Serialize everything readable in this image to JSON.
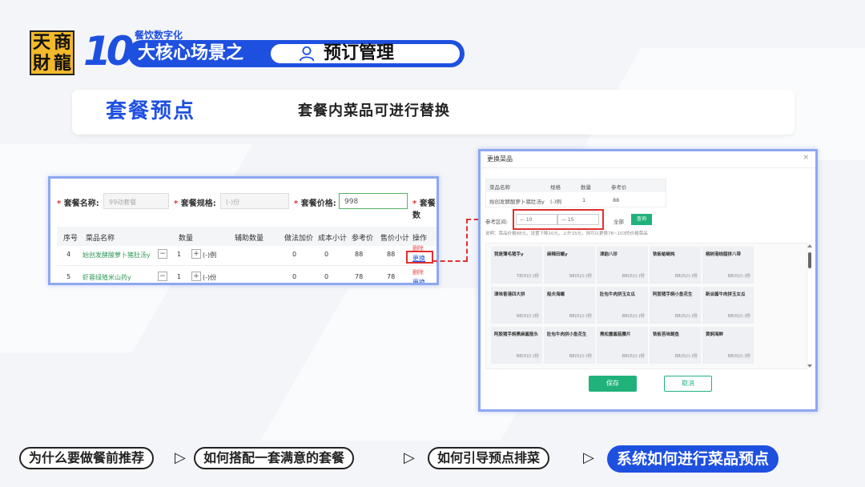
{
  "logo": {
    "chars": [
      "天",
      "商",
      "財",
      "龍"
    ]
  },
  "header": {
    "number": "10",
    "tag": "餐饮数字化",
    "banner_text": "大核心场景之",
    "pill_text": "预订管理",
    "pill_icon": "user-icon"
  },
  "section": {
    "title": "套餐预点",
    "description": "套餐内菜品可进行替换"
  },
  "left_panel": {
    "fields": [
      {
        "label": "套餐名称:",
        "placeholder": "99动套餐"
      },
      {
        "label": "套餐规格:",
        "placeholder": "(-)份"
      },
      {
        "label": "套餐价格:",
        "value": "998"
      },
      {
        "label": "套餐数"
      }
    ],
    "headers": [
      "序号",
      "菜品名称",
      "数量",
      "辅助数量",
      "做法加价",
      "成本小计",
      "参考价",
      "售价小计",
      "操作"
    ],
    "rows": [
      {
        "no": "4",
        "name": "始创发酵酸萝卜猪肚汤y",
        "qty": "1",
        "unit": "(-)例",
        "extra": "0",
        "cost": "0",
        "ref": "88",
        "sale": "88",
        "del": "删除",
        "replace": "更换"
      },
      {
        "no": "5",
        "name": "虾蓉绿殖米山药y",
        "qty": "1",
        "unit": "(-)份",
        "extra": "0",
        "cost": "0",
        "ref": "78",
        "sale": "78",
        "del": "删除",
        "replace": "更换"
      }
    ]
  },
  "right_panel": {
    "title": "更换菜品",
    "close": "×",
    "mini_headers": [
      "菜品名称",
      "规格",
      "数量",
      "参考价"
    ],
    "mini_row": [
      "始创发酵酸萝卜猪肚汤y",
      "(-)例",
      "1",
      "88"
    ],
    "range_label": "参考区间:",
    "range_min": "10",
    "range_max": "15",
    "range_dash": "—",
    "all_label": "全部",
    "query_btn": "查询",
    "hint": "说明：菜品价格88元，设置下降10元，上升15元，则可以更换78~103的价格菜品",
    "dishes": [
      {
        "name": "我是薄毛猪手y",
        "price": "78(0)/(-)份"
      },
      {
        "name": "麻辣田螺y",
        "price": "98(0)/(-)份"
      },
      {
        "name": "津韵八珍",
        "price": "88(0)/(-)份"
      },
      {
        "name": "铁板蛤蜊炖",
        "price": "88(0)/(-)份"
      },
      {
        "name": "榕树港烧腊拼八带",
        "price": "88(0)/(-)份"
      },
      {
        "name": "津味香港四大拼",
        "price": "98(0)/(-)份"
      },
      {
        "name": "船夫海螺",
        "price": "88(0)/(-)份"
      },
      {
        "name": "肚包牛肉拼玉女瓜",
        "price": "88(0)/(-)份"
      },
      {
        "name": "阿胶猪手焖小鱼花生",
        "price": "88(0)/(-)份"
      },
      {
        "name": "新派酱牛肉拼玉女瓜",
        "price": "88(0)/(-)份"
      },
      {
        "name": "阿胶猪手焖黑麻酱筋头",
        "price": "88(0)/(-)份"
      },
      {
        "name": "肚包牛肉拼小鱼花生",
        "price": "88(0)/(-)份"
      },
      {
        "name": "黑松露酱菇腰片",
        "price": "88(0)/(-)份"
      },
      {
        "name": "铁板苔味鲍鱼",
        "price": "88(0)/(-)份"
      },
      {
        "name": "黄焖海鲜",
        "price": "88(0)/(-)份"
      }
    ],
    "save": "保存",
    "cancel": "取消"
  },
  "bottom_nav": {
    "items": [
      "为什么要做餐前推荐",
      "如何搭配一套满意的套餐",
      "如何引导预点排菜",
      "系统如何进行菜品预点"
    ],
    "arrow": "▷"
  },
  "colors": {
    "brand_blue": "#1e50e0",
    "highlight_red": "#e03030",
    "green": "#20b27a",
    "logo_yellow": "#f2b92c"
  }
}
